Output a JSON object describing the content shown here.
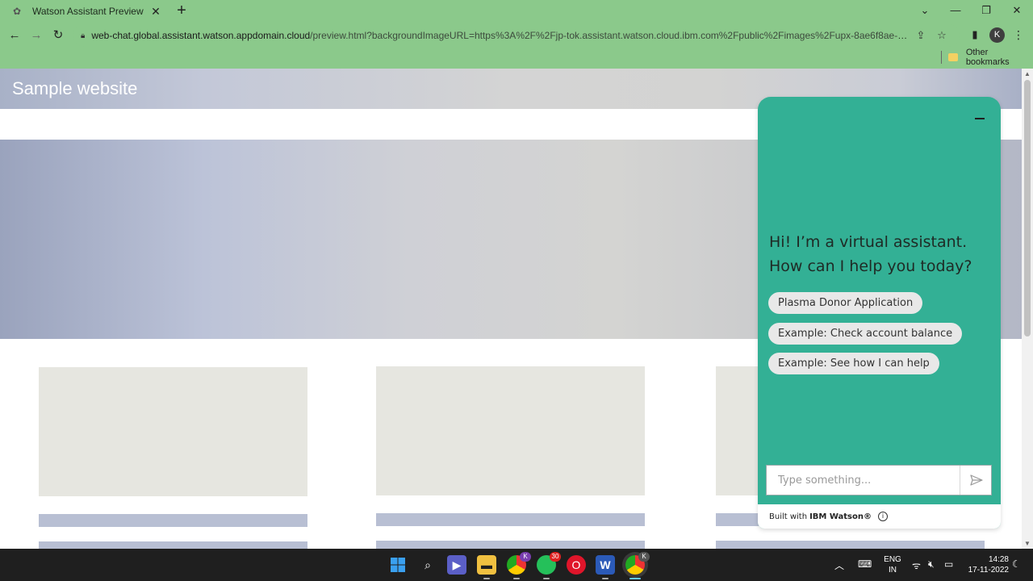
{
  "browser": {
    "tab_title": "Watson Assistant Preview",
    "url_host": "web-chat.global.assistant.watson.appdomain.cloud",
    "url_rest": "/preview.html?backgroundImageURL=https%3A%2F%2Fjp-tok.assistant.watson.cloud.ibm.com%2Fpublic%2Fimages%2Fupx-8ae6f8ae-d4c5-4bd...",
    "profile_initial": "K",
    "bookmarks_label": "Other bookmarks"
  },
  "site": {
    "title": "Sample website"
  },
  "chat": {
    "greeting": "Hi! I’m a virtual assistant. How can I help you today?",
    "options": [
      "Plasma Donor Application",
      "Example: Check account balance",
      "Example: See how I can help"
    ],
    "input_placeholder": "Type something...",
    "footer_prefix": "Built with",
    "footer_brand": "IBM Watson®",
    "accent_color": "#33b095"
  },
  "taskbar": {
    "whatsapp_badge": "30",
    "chrome_badge": "K",
    "lang_top": "ENG",
    "lang_bottom": "IN",
    "time": "14:28",
    "date": "17-11-2022"
  }
}
